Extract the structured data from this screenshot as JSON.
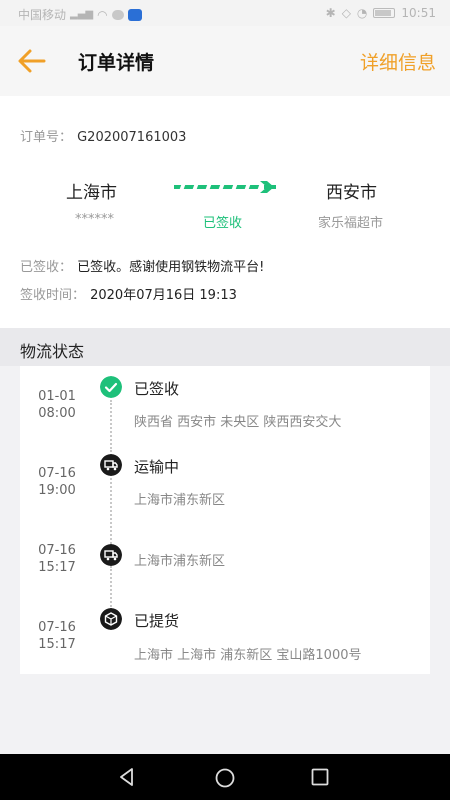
{
  "status_bar": {
    "carrier": "中国移动",
    "signal": "⁴⁶",
    "time": "10:51"
  },
  "header": {
    "title": "订单详情",
    "right_link": "详细信息"
  },
  "order": {
    "number_label": "订单号：",
    "number": "G202007161003",
    "origin_city": "上海市",
    "origin_sub": "******",
    "status": "已签收",
    "dest_city": "西安市",
    "dest_sub": "家乐福超市",
    "sign_label": "已签收：",
    "sign_text": "已签收。感谢使用钢铁物流平台!",
    "time_label": "签收时间：",
    "time_value": "2020年07月16日 19:13"
  },
  "logistics": {
    "section_title": "物流状态",
    "events": [
      {
        "date": "01-01",
        "time": "08:00",
        "status": "已签收",
        "address": "陕西省 西安市 未央区 陕西西安交大",
        "icon": "check-circle-icon"
      },
      {
        "date": "07-16",
        "time": "19:00",
        "status": "运输中",
        "address": "上海市浦东新区",
        "icon": "truck-icon"
      },
      {
        "date": "07-16",
        "time": "15:17",
        "status": "",
        "address": "上海市浦东新区",
        "icon": "truck-icon"
      },
      {
        "date": "07-16",
        "time": "15:17",
        "status": "已提货",
        "address": "上海市 上海市 浦东新区 宝山路1000号",
        "icon": "package-icon"
      }
    ]
  },
  "colors": {
    "accent": "#f0a028",
    "success": "#1ec07a",
    "dark_icon": "#1a1a1a"
  }
}
